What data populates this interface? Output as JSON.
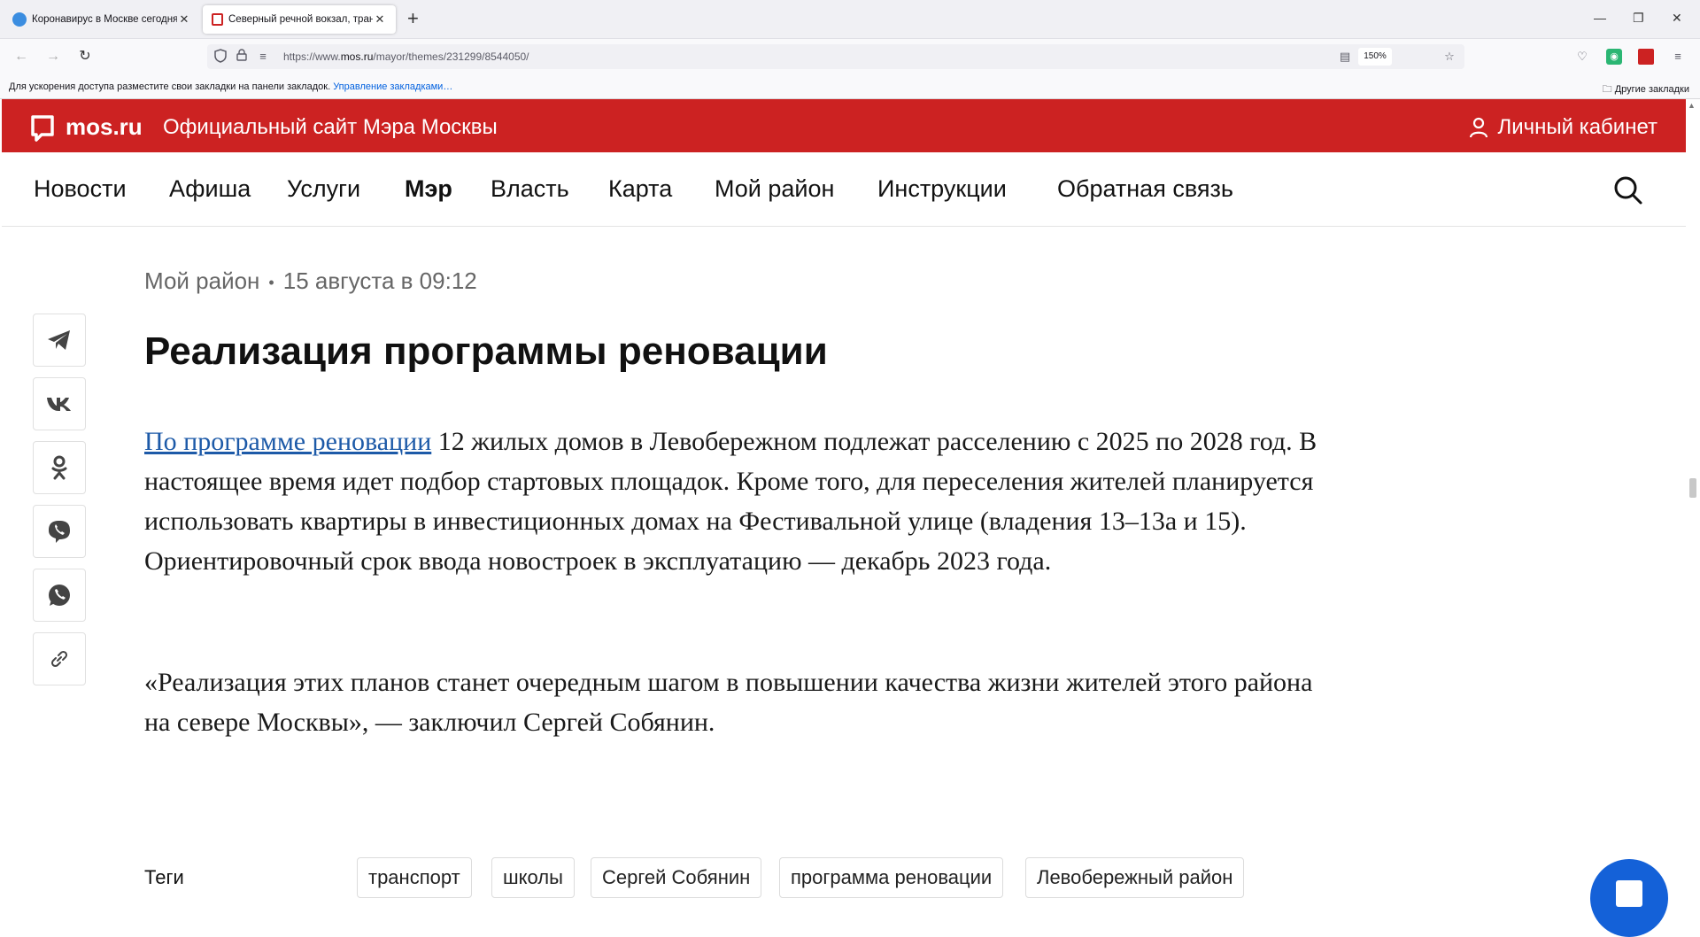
{
  "browser": {
    "tabs": [
      {
        "title": "Коронавирус в Москве сегодня –",
        "favicon_color": "#3b8de0"
      },
      {
        "title": "Северный речной вокзал, трансп",
        "favicon_color": "#cc2222"
      }
    ],
    "close_glyph": "✕",
    "new_tab_glyph": "+",
    "url_prefix": "https://www.",
    "url_domain": "mos.ru",
    "url_path": "/mayor/themes/231299/8544050/",
    "zoom": "150%",
    "bookmarks_hint": "Для ускорения доступа разместите свои закладки на панели закладок.",
    "bookmarks_manage": "Управление закладками…",
    "other_bookmarks": "Другие закладки"
  },
  "site": {
    "logo": "mos.ru",
    "subtitle": "Официальный сайт Мэра Москвы",
    "cabinet": "Личный кабинет",
    "brand_color": "#cc2222",
    "nav": [
      "Новости",
      "Афиша",
      "Услуги",
      "Мэр",
      "Власть",
      "Карта",
      "Мой район",
      "Инструкции",
      "Обратная связь"
    ],
    "nav_active": "Мэр"
  },
  "article": {
    "category": "Мой район",
    "date": "15 августа в 09:12",
    "title": "Реализация программы реновации",
    "p1_link": "По программе реновации",
    "p1_text": " 12 жилых домов в Левобережном подлежат расселению с 2025 по 2028 год. В настоящее время идет подбор стартовых площадок. Кроме того, для переселения жителей планируется использовать квартиры в инвестиционных домах на Фестивальной улице (владения 13–13а и 15). Ориентировочный срок ввода новостроек в эксплуатацию — декабрь 2023 года.",
    "p2_text": "«Реализация этих планов станет очередным шагом в повышении качества жизни жителей этого района на севере Москвы», — заключил Сергей Собянин.",
    "share_icons": [
      "telegram-icon",
      "vk-icon",
      "odnoklassniki-icon",
      "viber-icon",
      "whatsapp-icon",
      "link-icon"
    ],
    "tags_label": "Теги",
    "tags": [
      "транспорт",
      "школы",
      "Сергей Собянин",
      "программа реновации",
      "Левобережный район"
    ]
  }
}
